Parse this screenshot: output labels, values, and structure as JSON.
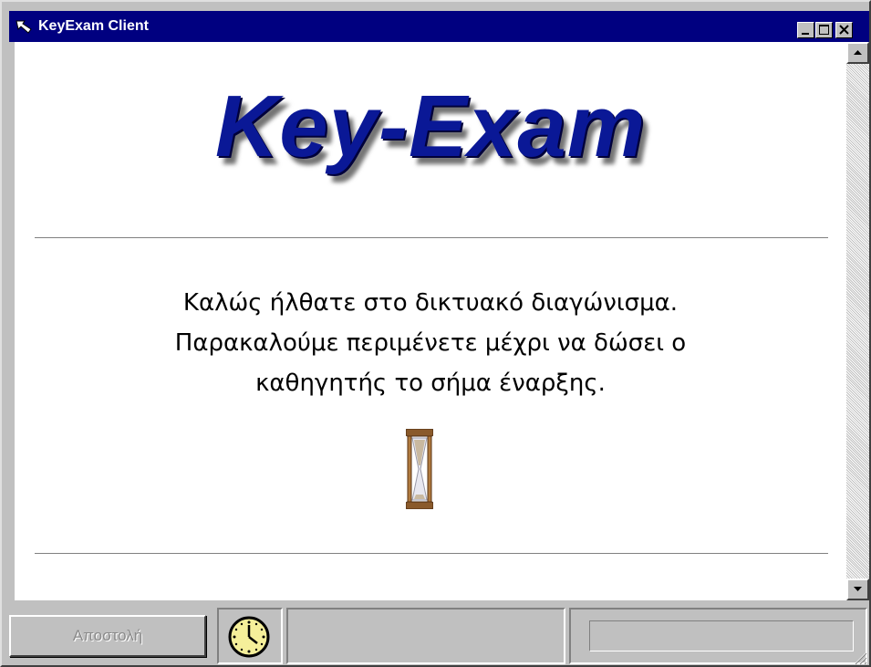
{
  "window": {
    "title": "KeyExam Client"
  },
  "main": {
    "logo_text": "Key-Exam",
    "message_lines": [
      "Καλώς ήλθατε στο δικτυακό διαγώνισμα.",
      "Παρακαλούμε περιμένετε μέχρι να δώσει ο",
      "καθηγητής το σήμα έναρξης."
    ]
  },
  "statusbar": {
    "send_label": "Αποστολή",
    "status_text": ""
  },
  "icons": {
    "app": "cursor-arrow-icon",
    "wait": "hourglass-icon",
    "clock": "clock-icon"
  },
  "colors": {
    "titlebar": "#000080",
    "logo": "#0a1896",
    "face": "#c0c0c0"
  }
}
